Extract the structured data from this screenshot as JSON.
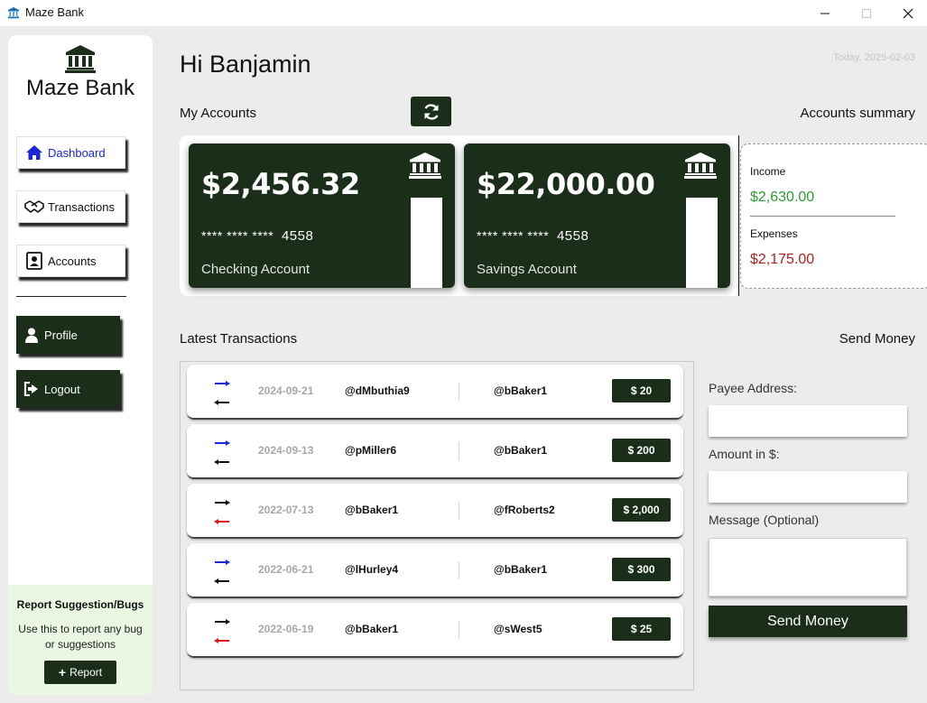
{
  "window": {
    "title": "Maze Bank",
    "minimize_icon": "minimize-icon",
    "maximize_icon": "maximize-icon",
    "close_icon": "close-icon"
  },
  "sidebar": {
    "brand": "Maze Bank",
    "logo_icon": "bank-icon",
    "nav": [
      {
        "label": "Dashboard",
        "icon": "home-icon",
        "active": true
      },
      {
        "label": "Transactions",
        "icon": "handshake-icon"
      },
      {
        "label": "Accounts",
        "icon": "account-card-icon"
      }
    ],
    "profile_label": "Profile",
    "logout_label": "Logout",
    "report": {
      "title": "Report Suggestion/Bugs",
      "text": "Use this to report any bug or suggestions",
      "button_label": "Report"
    }
  },
  "header": {
    "greeting": "Hi Banjamin",
    "date": "Today, 2025-02-03"
  },
  "accounts": {
    "section_label": "My Accounts",
    "summary_label": "Accounts summary",
    "cards": [
      {
        "balance": "$2,456.32",
        "masked": "**** **** ****",
        "last4": "4558",
        "type": "Checking Account"
      },
      {
        "balance": "$22,000.00",
        "masked": "**** **** ****",
        "last4": "4558",
        "type": "Savings Account"
      }
    ]
  },
  "summary": {
    "income_label": "Income",
    "income_value": "$2,630.00",
    "expenses_label": "Expenses",
    "expenses_value": "$2,175.00"
  },
  "transactions": {
    "section_label": "Latest Transactions",
    "rows": [
      {
        "direction": "incoming",
        "date": "2024-09-21",
        "sender": "@dMbuthia9",
        "receiver": "@bBaker1",
        "amount": "$ 20"
      },
      {
        "direction": "incoming",
        "date": "2024-09-13",
        "sender": "@pMiller6",
        "receiver": "@bBaker1",
        "amount": "$ 200"
      },
      {
        "direction": "outgoing",
        "date": "2022-07-13",
        "sender": "@bBaker1",
        "receiver": "@fRoberts2",
        "amount": "$ 2,000"
      },
      {
        "direction": "incoming",
        "date": "2022-06-21",
        "sender": "@lHurley4",
        "receiver": "@bBaker1",
        "amount": "$ 300"
      },
      {
        "direction": "outgoing",
        "date": "2022-06-19",
        "sender": "@bBaker1",
        "receiver": "@sWest5",
        "amount": "$ 25"
      }
    ]
  },
  "send_money": {
    "section_label": "Send Money",
    "payee_label": "Payee Address:",
    "payee_value": "",
    "amount_label": "Amount in $:",
    "amount_value": "",
    "message_label": "Message (Optional)",
    "message_value": "",
    "button_label": "Send Money"
  },
  "colors": {
    "dark_green": "#1b2e1a",
    "income_green": "#2e9a33",
    "expense_red": "#b21f1f",
    "active_blue": "#1a27d6",
    "incoming_arrow": "#1a27d6",
    "outgoing_arrow": "#e01414"
  }
}
